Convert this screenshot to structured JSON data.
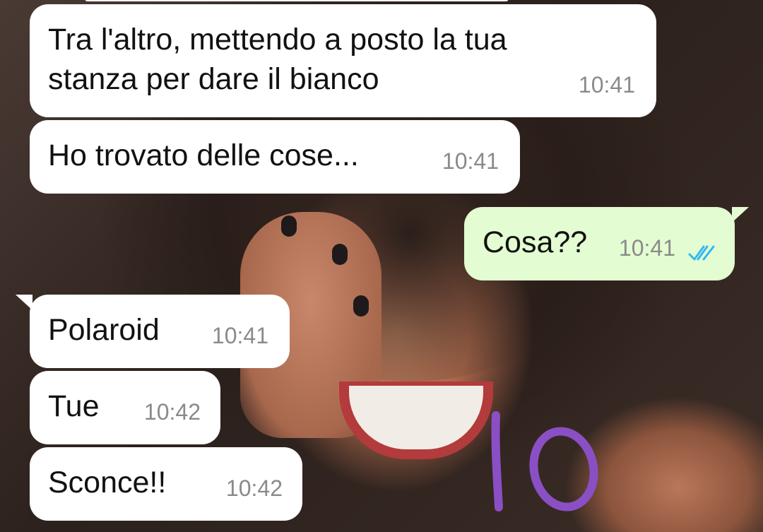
{
  "chat": {
    "messages": [
      {
        "id": "m1",
        "direction": "incoming",
        "text": "Tra l'altro, mettendo a posto la tua\nstanza per dare il bianco",
        "time": "10:41"
      },
      {
        "id": "m2",
        "direction": "incoming",
        "text": "Ho trovato delle cose...",
        "time": "10:41"
      },
      {
        "id": "m3",
        "direction": "outgoing",
        "text": "Cosa??",
        "time": "10:41",
        "status": "read"
      },
      {
        "id": "m4",
        "direction": "incoming",
        "text": "Polaroid",
        "time": "10:41"
      },
      {
        "id": "m5",
        "direction": "incoming",
        "text": "Tue",
        "time": "10:42"
      },
      {
        "id": "m6",
        "direction": "incoming",
        "text": "Sconce!!",
        "time": "10:42"
      }
    ]
  },
  "overlay": {
    "handwritten_rating": "10",
    "handwritten_color": "#8a4fc4"
  },
  "colors": {
    "incoming_bubble": "#ffffff",
    "outgoing_bubble": "#e3fcd2",
    "read_ticks": "#34b7f1",
    "timestamp": "#8a8a8a"
  },
  "icons": {
    "read_status": "double-check-icon"
  }
}
